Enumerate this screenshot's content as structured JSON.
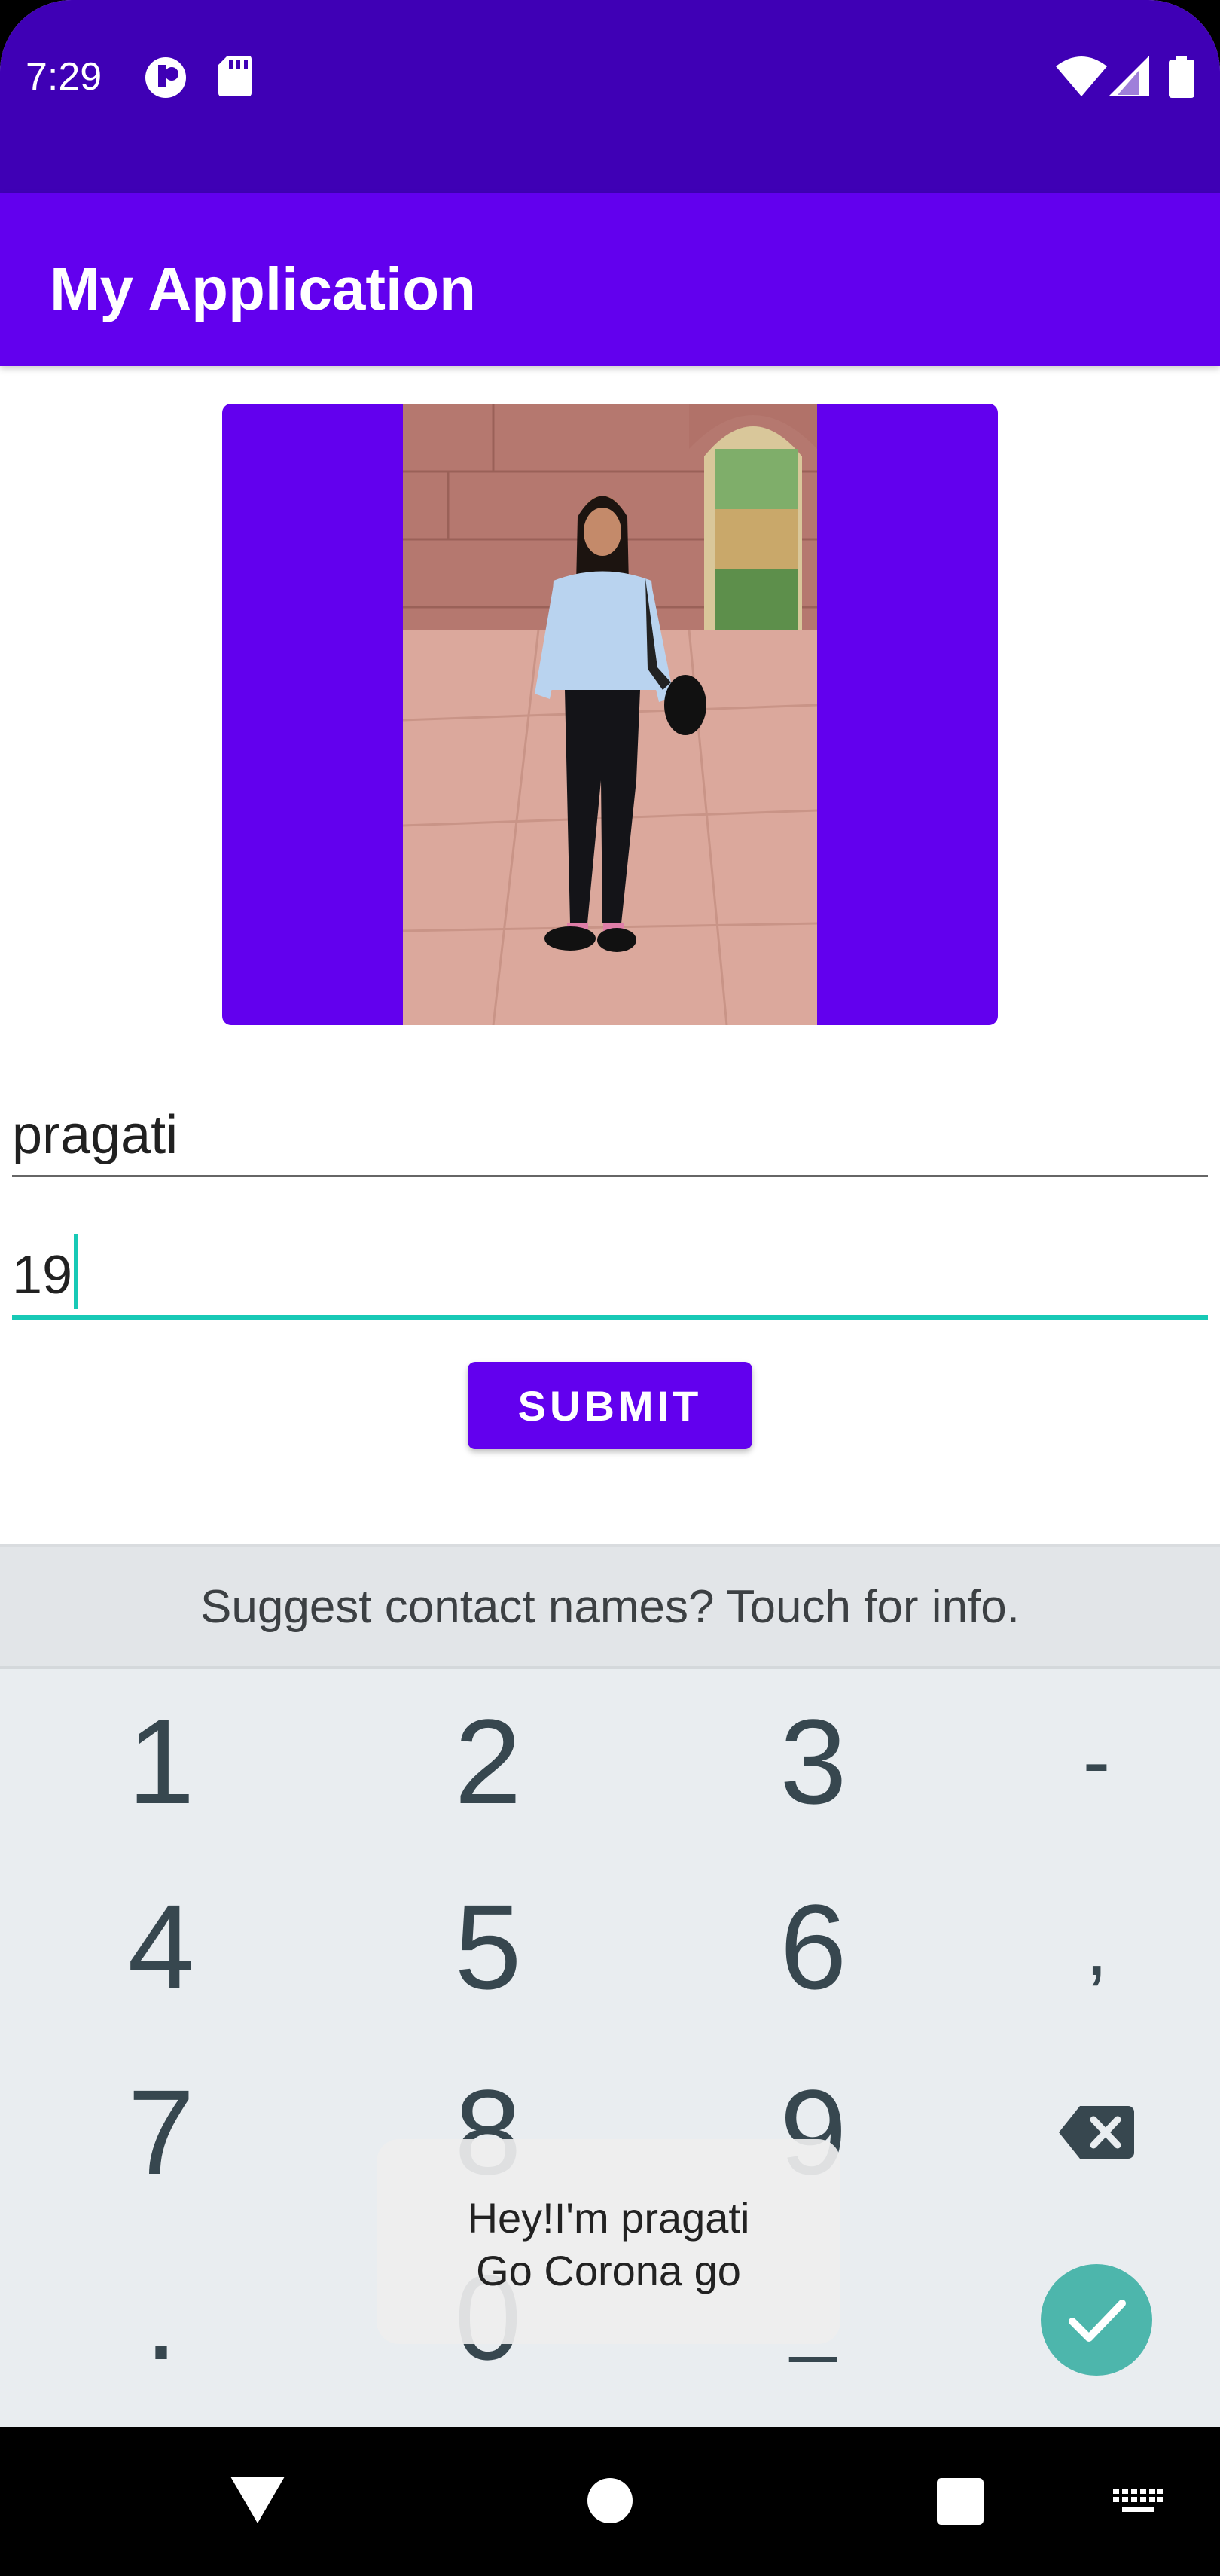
{
  "status_bar": {
    "time": "7:29",
    "icons": [
      "sync-icon",
      "sd-card-icon",
      "wifi-icon",
      "signal-icon",
      "battery-icon"
    ]
  },
  "app_bar": {
    "title": "My Application"
  },
  "form": {
    "name_value": "pragati",
    "age_value": "19",
    "submit_label": "SUBMIT"
  },
  "keyboard": {
    "suggestion": "Suggest contact names? Touch for info.",
    "keys": {
      "k1": "1",
      "k2": "2",
      "k3": "3",
      "dash": "-",
      "k4": "4",
      "k5": "5",
      "k6": "6",
      "comma": ",",
      "k7": "7",
      "k8": "8",
      "k9": "9",
      "dot": ".",
      "k0": "0",
      "space": "_"
    }
  },
  "toast": {
    "line1": "Hey!I'm pragati",
    "line2": "Go Corona go"
  },
  "nav_bar": {
    "icons": [
      "back-icon",
      "home-icon",
      "recents-icon",
      "keyboard-switch-icon"
    ]
  },
  "colors": {
    "status_bar": "#3f00b5",
    "primary": "#6200ee",
    "accent": "#18c9b6",
    "keyboard_bg": "#e9edf0",
    "enter_key": "#4db6ac"
  }
}
